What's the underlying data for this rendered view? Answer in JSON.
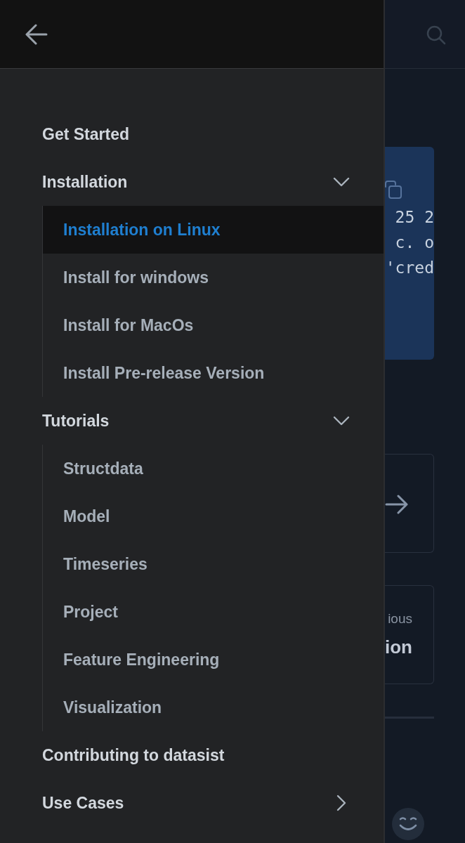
{
  "drawer": {
    "nav": [
      {
        "label": "Get Started",
        "selected": false
      },
      {
        "label": "Installation",
        "selected": false,
        "expanded": true,
        "children": [
          {
            "label": "Installation on Linux",
            "selected": true
          },
          {
            "label": "Install for windows",
            "selected": false
          },
          {
            "label": "Install for MacOs",
            "selected": false
          },
          {
            "label": "Install Pre-release Version",
            "selected": false
          }
        ]
      },
      {
        "label": "Tutorials",
        "selected": false,
        "expanded": true,
        "children": [
          {
            "label": "Structdata",
            "selected": false
          },
          {
            "label": "Model",
            "selected": false
          },
          {
            "label": "Timeseries",
            "selected": false
          },
          {
            "label": "Project",
            "selected": false
          },
          {
            "label": "Feature Engineering",
            "selected": false
          },
          {
            "label": "Visualization",
            "selected": false
          }
        ]
      },
      {
        "label": "Contributing to datasist",
        "selected": false
      },
      {
        "label": "Use Cases",
        "selected": false,
        "expanded": false
      }
    ]
  },
  "page": {
    "code_block": {
      "lines": [
        "25 2",
        "c. o",
        "'cred"
      ]
    },
    "cards": [
      {
        "kind": "arrow"
      },
      {
        "kind": "text",
        "label": "ious",
        "title": "ion"
      }
    ]
  }
}
